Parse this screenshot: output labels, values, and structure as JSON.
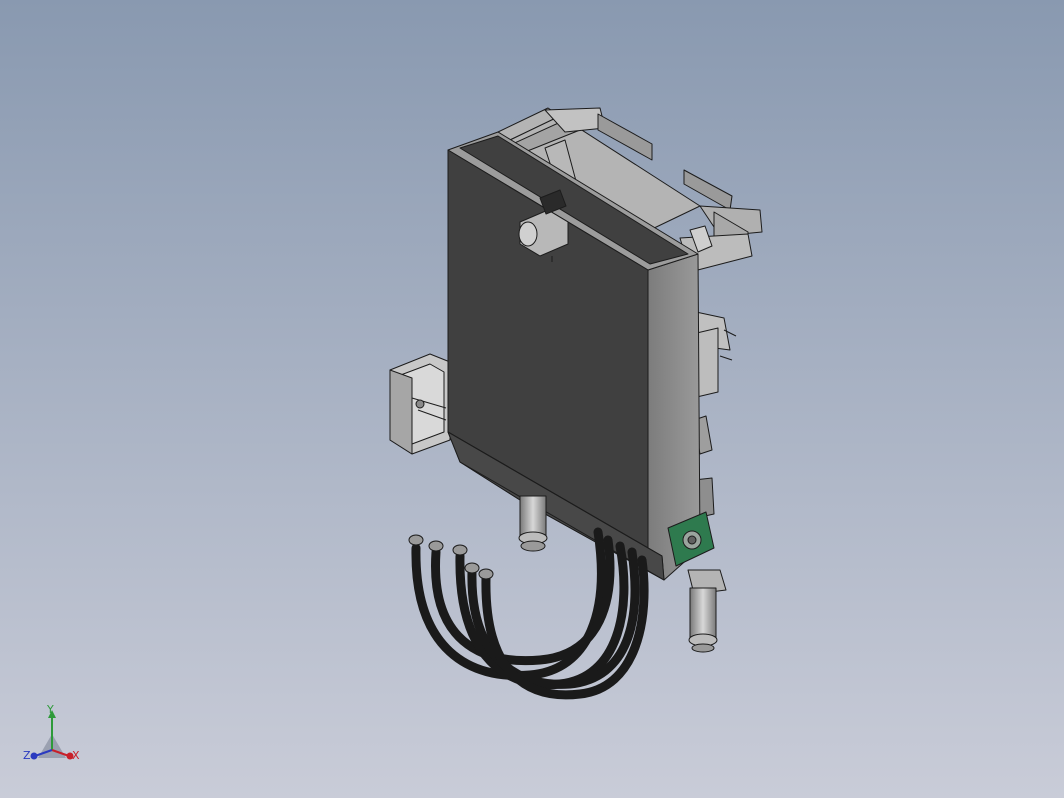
{
  "viewport": {
    "background_top": "#8999b0",
    "background_bottom": "#c9ccd8"
  },
  "model": {
    "panel_color": "#404040",
    "side_color": "#8a8a8a",
    "frame_color": "#b4b4b4",
    "edge_color": "#1c1c1c",
    "hose_color": "#1a1a1a",
    "bearing_color": "#2e7a4e"
  },
  "triad": {
    "x_label": "X",
    "y_label": "Y",
    "z_label": "Z",
    "x_color": "#c8202a",
    "y_color": "#2e9a3a",
    "z_color": "#2a3ac0"
  }
}
